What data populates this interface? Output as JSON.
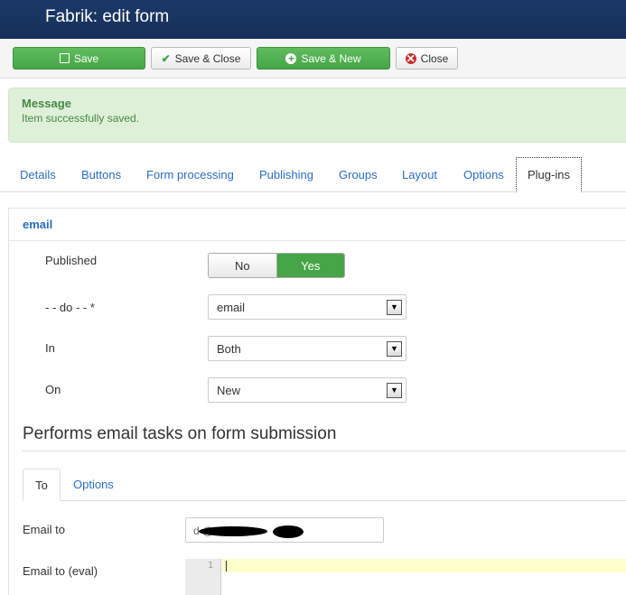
{
  "header": {
    "title": "Fabrik: edit form"
  },
  "toolbar": {
    "save": "Save",
    "save_close": "Save & Close",
    "save_new": "Save & New",
    "close": "Close"
  },
  "message": {
    "title": "Message",
    "text": "Item successfully saved."
  },
  "tabs": [
    {
      "label": "Details"
    },
    {
      "label": "Buttons"
    },
    {
      "label": "Form processing"
    },
    {
      "label": "Publishing"
    },
    {
      "label": "Groups"
    },
    {
      "label": "Layout"
    },
    {
      "label": "Options"
    },
    {
      "label": "Plug-ins",
      "active": true
    }
  ],
  "plugin": {
    "heading": "email",
    "published_label": "Published",
    "published_no": "No",
    "published_yes": "Yes",
    "published_value": "Yes",
    "do_label": "- - do - - *",
    "do_value": "email",
    "in_label": "In",
    "in_value": "Both",
    "on_label": "On",
    "on_value": "New"
  },
  "section": {
    "title": "Performs email tasks on form submission",
    "subtabs": [
      {
        "label": "To",
        "active": true
      },
      {
        "label": "Options"
      }
    ],
    "email_to_label": "Email to",
    "email_to_value": "d                          @          .com",
    "email_eval_label": "Email to (eval)",
    "eval_line_number": "1"
  },
  "colors": {
    "header_bg": "#17305a",
    "primary_green": "#46a546",
    "link_blue": "#2a6ec2",
    "message_bg": "#dff0d8"
  }
}
